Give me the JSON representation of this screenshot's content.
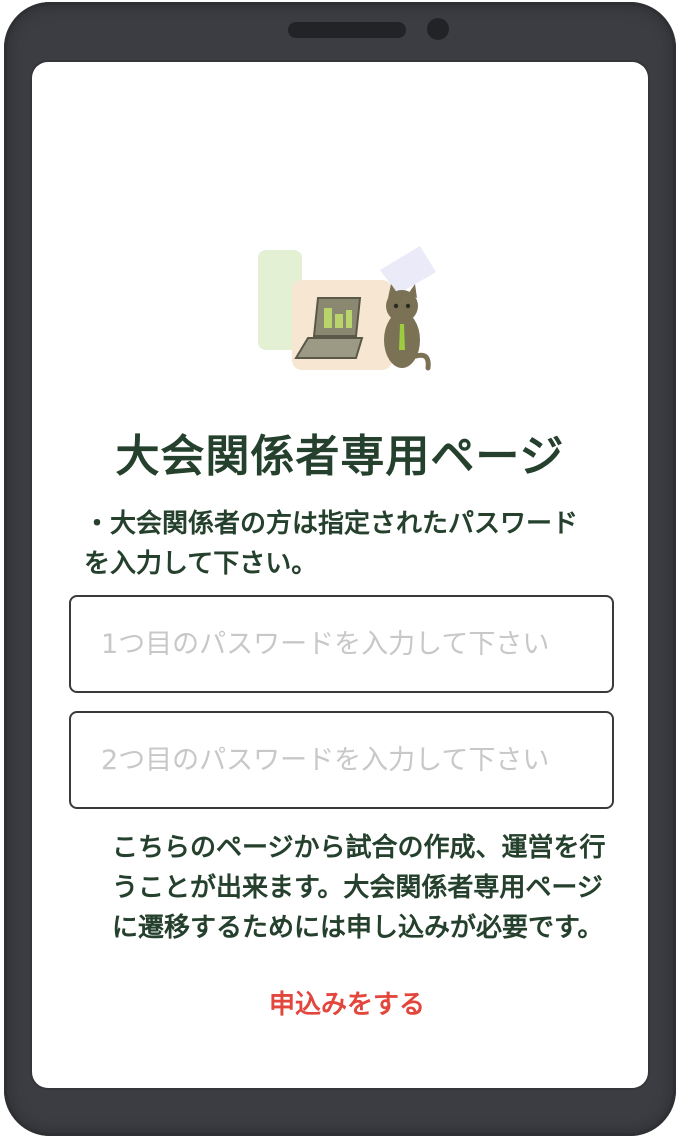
{
  "page": {
    "title": "大会関係者専用ページ",
    "instruction": "・大会関係者の方は指定されたパスワードを入力して下さい。"
  },
  "form": {
    "password1_placeholder": "1つ目のパスワードを入力して下さい",
    "password2_placeholder": "2つ目のパスワードを入力して下さい"
  },
  "note": {
    "text": "こちらのページから試合の作成、運営を行うことが出来ます。大会関係者専用ページに遷移するためには申し込みが必要です。"
  },
  "apply": {
    "label": "申込みをする",
    "color": "#e2463c"
  },
  "colors": {
    "frame": "#3b3d42",
    "text": "#25412d"
  }
}
